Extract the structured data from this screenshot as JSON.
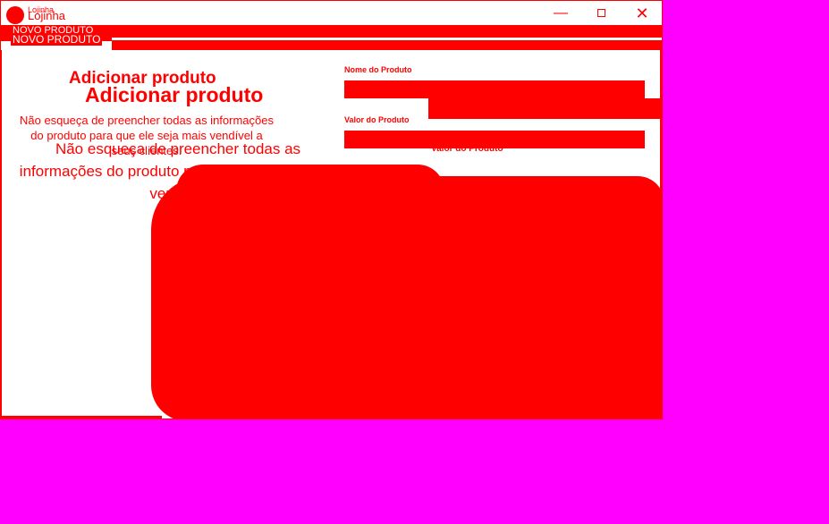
{
  "window": {
    "app_title": "Lojinha",
    "app_title_ghost": "Lojinha",
    "minimize_glyph": "—",
    "close_glyph": "✕"
  },
  "header": {
    "section_title": "NOVO PRODUTO",
    "section_title_ghost": "NOVO PRODUTO"
  },
  "intro": {
    "heading_small": "Adicionar produto",
    "heading_large": "Adicionar produto",
    "desc_small": "Não esqueça de preencher todas as informações do produto para que ele seja mais vendível a seus clientes.",
    "desc_large": "Não esqueça de preencher todas as informações do produto para que ele seja mais vendível"
  },
  "form": {
    "name_label": "Nome do Produto",
    "value_label": "Valor do Produto",
    "value_label_ghost": "Valor do Produto",
    "name_value": "",
    "value_value": ""
  },
  "colors": {
    "accent": "#ff0000",
    "background": "#ffffff",
    "chroma": "#ff00ff"
  },
  "icons": {
    "logo": "logo-icon",
    "minimize": "minimize-icon",
    "maximize": "maximize-icon",
    "close": "close-icon"
  }
}
